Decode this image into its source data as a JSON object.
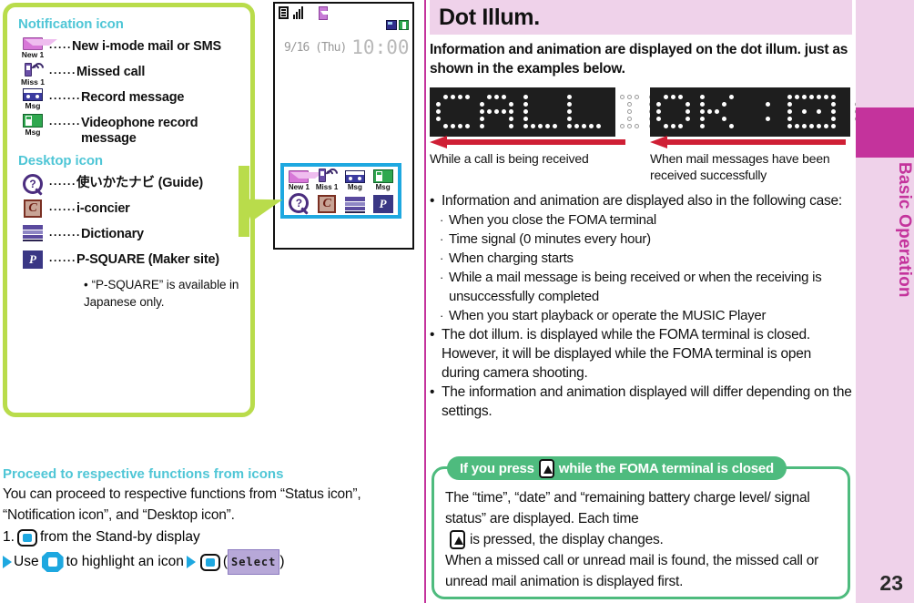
{
  "left": {
    "notification_box": {
      "section1_title": "Notification icon",
      "section2_title": "Desktop icon",
      "notification_items": [
        {
          "icon": "new-mail-icon",
          "caption": "New 1",
          "dots": "·····",
          "label": "New i-mode mail or SMS"
        },
        {
          "icon": "missed-call-icon",
          "caption": "Miss 1",
          "dots": "······",
          "label": "Missed call"
        },
        {
          "icon": "record-message-icon",
          "caption": "Msg",
          "dots": "·······",
          "label": "Record message"
        },
        {
          "icon": "videophone-record-icon",
          "caption": "Msg",
          "dots": "·······",
          "label": "Videophone record message"
        }
      ],
      "desktop_items": [
        {
          "icon": "guide-icon",
          "dots": "······",
          "label": "使いかたナビ (Guide)"
        },
        {
          "icon": "i-concier-icon",
          "dots": "······",
          "label": "i-concier"
        },
        {
          "icon": "dictionary-icon",
          "dots": "·······",
          "label": "Dictionary"
        },
        {
          "icon": "p-square-icon",
          "dots": "······",
          "label": "P-SQUARE (Maker site)"
        }
      ],
      "desktop_note_bullet": "•",
      "desktop_note": "“P-SQUARE” is available in Japanese only."
    },
    "phone": {
      "date": "9/16 (Thu)",
      "time": "10:00",
      "icon_panel_row1": [
        {
          "icon": "new-mail-icon",
          "caption": "New 1"
        },
        {
          "icon": "missed-call-icon",
          "caption": "Miss 1"
        },
        {
          "icon": "record-message-icon",
          "caption": "Msg"
        },
        {
          "icon": "videophone-record-icon",
          "caption": "Msg"
        }
      ],
      "icon_panel_row2": [
        {
          "icon": "guide-icon"
        },
        {
          "icon": "i-concier-icon"
        },
        {
          "icon": "dictionary-icon"
        },
        {
          "icon": "p-square-icon"
        }
      ]
    },
    "proceed": {
      "title": "Proceed to respective functions from icons",
      "body": "You can proceed to respective functions from “Status icon”, “Notification icon”, and “Desktop icon”.",
      "step_number": "1.",
      "step_text": "from the Stand-by display",
      "substep_use": "Use",
      "substep_mid": "to highlight an icon",
      "select_label": "Select",
      "paren_open": "(",
      "paren_close": ")"
    }
  },
  "right": {
    "title": "Dot Illum.",
    "lead": "Information and animation are displayed on the dot illum. just as shown in the examples below.",
    "examples": [
      {
        "on_text": "CALL",
        "off_text": "ING",
        "caption": "While a call is being received"
      },
      {
        "on_text": "OK :)",
        "off_text": "OK",
        "caption": "When mail messages have been received successfully"
      }
    ],
    "notes": [
      {
        "bullet": "•",
        "text": "Information and animation are displayed also in the following case:"
      },
      {
        "bullet": "·",
        "sub": true,
        "text": "When you close the FOMA terminal"
      },
      {
        "bullet": "·",
        "sub": true,
        "text": "Time signal (0 minutes every hour)"
      },
      {
        "bullet": "·",
        "sub": true,
        "text": "When charging starts"
      },
      {
        "bullet": "·",
        "sub": true,
        "text": "While a mail message is being received or when the receiving is unsuccessfully completed"
      },
      {
        "bullet": "·",
        "sub": true,
        "text": "When you start playback or operate the MUSIC Player"
      },
      {
        "bullet": "•",
        "text": "The dot illum. is displayed while the FOMA terminal is closed. However, it will be displayed while the FOMA terminal is open during camera shooting."
      },
      {
        "bullet": "•",
        "text": "The information and animation displayed will differ depending on the settings."
      }
    ],
    "press_panel": {
      "header_pre": "If you press",
      "header_post": "while the FOMA terminal is closed",
      "line1": "The “time”, “date” and “remaining battery charge level/ signal status” are displayed. Each time",
      "line1_end": "is pressed, the display changes.",
      "line2": "When a missed call or unread mail is found, the missed call or unread mail animation is displayed first."
    }
  },
  "rail": {
    "chapter_title": "Basic Operation",
    "page_number": "23"
  },
  "colors": {
    "cyan_heading": "#4FC6D6",
    "green_border": "#B9DC4B",
    "magenta": "#C4339C",
    "pink_bg": "#EFD2EA",
    "green_panel": "#4EBB7E",
    "red_arrow": "#CF1F35",
    "blue_highlight": "#1EA8E0"
  },
  "dot_patterns": {
    "call_on": [
      [
        0,
        1,
        1,
        1
      ],
      [
        1,
        0,
        0,
        0
      ],
      [
        1,
        0,
        0,
        0
      ],
      [
        1,
        0,
        0,
        0
      ],
      [
        0,
        1,
        1,
        1
      ],
      [
        0,
        0,
        0,
        0
      ],
      [
        0,
        1,
        1,
        1
      ],
      [
        1,
        0,
        1,
        0
      ],
      [
        1,
        0,
        1,
        0
      ],
      [
        1,
        0,
        1,
        0
      ],
      [
        0,
        1,
        1,
        1
      ],
      [
        0,
        0,
        0,
        0
      ],
      [
        1,
        0,
        0,
        0
      ],
      [
        1,
        0,
        0,
        0
      ],
      [
        1,
        0,
        0,
        0
      ],
      [
        1,
        0,
        0,
        0
      ],
      [
        1,
        1,
        1,
        1
      ],
      [
        0,
        0,
        0,
        0
      ],
      [
        1,
        0,
        0,
        0
      ],
      [
        1,
        0,
        0,
        0
      ],
      [
        1,
        0,
        0,
        0
      ],
      [
        1,
        0,
        0,
        0
      ],
      [
        1,
        1,
        1,
        1
      ]
    ]
  }
}
